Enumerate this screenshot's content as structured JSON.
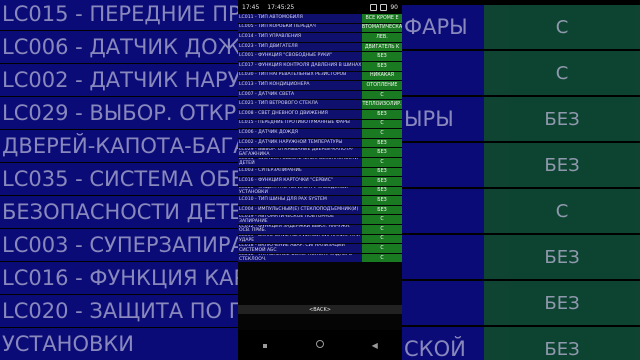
{
  "status_bar": {
    "time_left": "17:45",
    "time_center": "17:45:25",
    "battery": "90"
  },
  "rows": [
    {
      "label": "LC011 - ТИП АВТОМОБИЛЯ",
      "value": "ВСЕ КРОМЕ E"
    },
    {
      "label": "LC005 - ТИП КОРОБКИ ПЕРЕДАЧ",
      "value": "АВТОМАТИЧЕСКАЯ"
    },
    {
      "label": "LC014 - ТИП УПРАВЛЕНИЯ",
      "value": "ЛЕВ."
    },
    {
      "label": "LC023 - ТИП ДВИГАТЕЛЯ",
      "value": "ДВИГАТЕЛЬ K"
    },
    {
      "label": "LC001 - ФУНКЦИЯ \"СВОБОДНЫЕ РУКИ\"",
      "value": "БЕЗ"
    },
    {
      "label": "LC017 - ФУНКЦИЯ КОНТРОЛЯ ДАВЛЕНИЯ В ШИНАХ",
      "value": "БЕЗ"
    },
    {
      "label": "LC030 - ТИП НАГРЕВАТЕЛЬНЫХ РЕЗИСТОРОВ",
      "value": "НИКАКАЯ"
    },
    {
      "label": "LC013 - ТИП КОНДИЦИОНЕРА",
      "value": "ОТОПЛЕНИЕ"
    },
    {
      "label": "LC007 - ДАТЧИК СВЕТА",
      "value": "С"
    },
    {
      "label": "LC021 - ТИП ВЕТРОВОГО СТЕКЛА",
      "value": "ТЕПЛОИЗОЛИР."
    },
    {
      "label": "LC008 - СВЕТ ДНЕВНОГО ДВИЖЕНИЯ",
      "value": "БЕЗ"
    },
    {
      "label": "LC015 - ПЕРЕДНИЕ ПРОТИВОТУМАННЫЕ ФАРЫ",
      "value": "С"
    },
    {
      "label": "LC006 - ДАТЧИК ДОЖДЯ",
      "value": "С"
    },
    {
      "label": "LC002 - ДАТЧИК НАРУЖНОЙ ТЕМПЕРАТУРЫ",
      "value": "БЕЗ"
    },
    {
      "label": "LC029 - ВЫБОР. ОТКРЫВАНИЕ ДВЕРЕЙ-КАПОТА-БАГАЖНИКА",
      "value": "БЕЗ"
    },
    {
      "label": "LC035 - СИСТЕМА ОБЕСПЕЧЕНИЯ БЕЗОПАСНОСТИ ДЕТЕЙ",
      "value": "С"
    },
    {
      "label": "LC003 - СУПЕРЗАПИРАНИЕ",
      "value": "БЕЗ"
    },
    {
      "label": "LC016 - ФУНКЦИЯ КАРТОЧКИ \"СЕРВИС\"",
      "value": "БЕЗ"
    },
    {
      "label": "LC020 - ЗАЩИТА ПО ПЕРИМЕТРУ ЗАВОДСКОЙ УСТАНОВКИ",
      "value": "БЕЗ"
    },
    {
      "label": "LC010 - ТИП ШИНЫ ДЛЯ PAX SYSTEM",
      "value": "БЕЗ"
    },
    {
      "label": "LC004 - ИМПУЛЬСНЫЙ(Е) СТЕКЛОПОДЪЕМНИК(И)",
      "value": "БЕЗ"
    },
    {
      "label": "LC019 - АВТОМАТИЧЕСКОЕ ПОВТОРНОЕ ЗАПИРАНИЕ",
      "value": "С"
    },
    {
      "label": "LC012 - ФУНКЦИЯ ЗАДЕРЖКИ ВЫКЛ. НАРУЖН. ОСВ. ПРИБ.",
      "value": "С"
    },
    {
      "label": "LC009 - ВКЛЮЧЕНИЕ АВАРИЙНОЙ СИГНАЛИЗ. ПРИ УДАРЕ",
      "value": "С"
    },
    {
      "label": "LC018 - ВКЛЮЧЕНИЕ АВАР. СИГНАЛИЗАЦИИ СИСТЕМОЙ АБС",
      "value": "С"
    },
    {
      "label": "LC018 - УПРАВЛЕНИЕ ФИКС. ПОЛОЖ. ЗАДНЕГО СТЕКЛООЧ.",
      "value": "С"
    }
  ],
  "back_label": "<BACK>",
  "background": {
    "left_lines": [
      "LC015 - ПЕРЕДНИЕ ПРОТИВОТУМАННЫЕ ФАРЫ",
      "LC006 - ДАТЧИК ДОЖДЯ",
      "LC002 - ДАТЧИК НАРУЖНОЙ ТЕМПЕРАТУРЫ",
      "LC029 - ВЫБОР. ОТКРЫВАНИЕ",
      "ДВЕРЕЙ-КАПОТА-БАГАЖНИКА",
      "LC035 - СИСТЕМА ОБЕСПЕЧЕНИЯ",
      "БЕЗОПАСНОСТИ ДЕТЕЙ",
      "LC003 - СУПЕРЗАПИРАНИЕ",
      "LC016 - ФУНКЦИЯ КАРТОЧКИ",
      "LC020 - ЗАЩИТА ПО ПЕРИМЕТРУ ЗАВОДСКОЙ",
      "УСТАНОВКИ"
    ],
    "right_lines": [
      {
        "label": "ФАРЫ",
        "value": "С"
      },
      {
        "label": "",
        "value": "С"
      },
      {
        "label": "ЫРЫ",
        "value": "БЕЗ"
      },
      {
        "label": "",
        "value": "БЕЗ"
      },
      {
        "label": "",
        "value": "С"
      },
      {
        "label": "",
        "value": "БЕЗ"
      },
      {
        "label": "",
        "value": "БЕЗ"
      },
      {
        "label": "СКОЙ",
        "value": "БЕЗ"
      }
    ]
  }
}
